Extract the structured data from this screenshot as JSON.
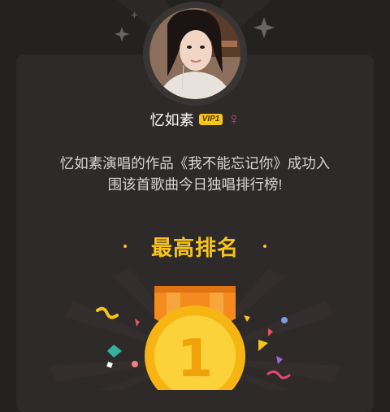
{
  "user": {
    "name": "忆如素",
    "vip_label": "VIP1",
    "gender_symbol": "♀"
  },
  "message": {
    "line1": "忆如素演唱的作品《我不能忘记你》成功入",
    "line2": "围该首歌曲今日独唱排行榜!"
  },
  "rank": {
    "title": "最高排名",
    "position": "1"
  },
  "icons": {
    "sparkle": "sparkle-icon",
    "medal": "gold-medal-icon",
    "gender": "female-icon"
  },
  "colors": {
    "background": "#242121",
    "card": "#2e2a2a",
    "accent_gold": "#f7c31c",
    "medal_ribbon": "#f58a1f",
    "gender_pink": "#e5398d"
  }
}
